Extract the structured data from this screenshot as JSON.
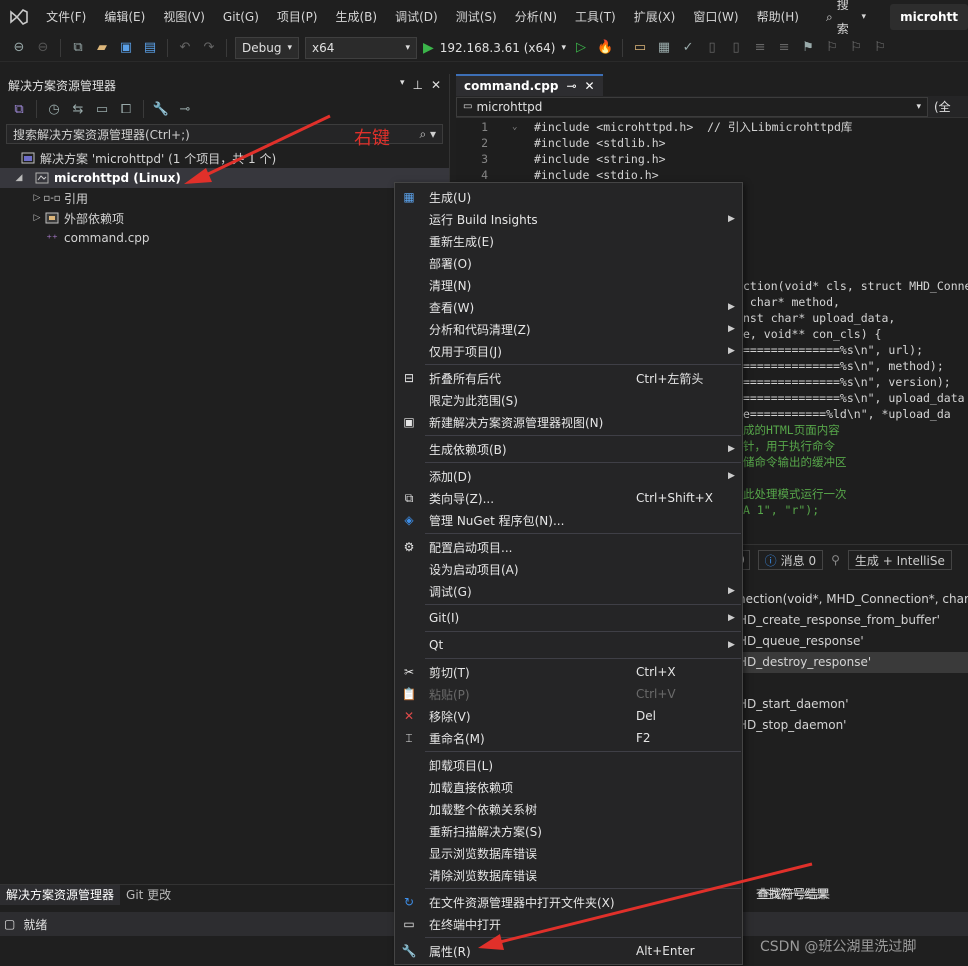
{
  "menubar": {
    "items": [
      "文件(F)",
      "编辑(E)",
      "视图(V)",
      "Git(G)",
      "项目(P)",
      "生成(B)",
      "调试(D)",
      "测试(S)",
      "分析(N)",
      "工具(T)",
      "扩展(X)",
      "窗口(W)",
      "帮助(H)"
    ],
    "search_label": "搜索",
    "solution_name": "microhtt"
  },
  "toolbar": {
    "configuration": "Debug",
    "platform": "x64",
    "run_target": "192.168.3.61 (x64)"
  },
  "solution_explorer": {
    "title": "解决方案资源管理器",
    "search_placeholder": "搜索解决方案资源管理器(Ctrl+;)",
    "tree": {
      "solution": "解决方案 'microhttpd' (1 个项目，共 1 个)",
      "project": "microhttpd (Linux)",
      "references": "引用",
      "external_deps": "外部依赖项",
      "file": "command.cpp"
    },
    "annotation": "右键"
  },
  "editor": {
    "tab_label": "command.cpp",
    "nav_project": "microhttpd",
    "nav_scope": "(全",
    "lines": [
      {
        "num": "1",
        "text": "#include <microhttpd.h>  // 引入Libmicrohttpd库"
      },
      {
        "num": "2",
        "text": "#include <stdlib.h>"
      },
      {
        "num": "3",
        "text": "#include <string.h>"
      },
      {
        "num": "4",
        "text": "#include <stdio.h>"
      }
    ],
    "fragments": [
      "ction(void* cls, struct MHD_Conne",
      " char* method,",
      "nst char* upload_data,",
      "e, void** con_cls) {",
      "==============%s\\n\", url);",
      "==============%s\\n\", method);",
      "==============%s\\n\", version);",
      "==============%s\\n\", upload_data",
      "e===========%ld\\n\", *upload_da",
      "成的HTML页面内容",
      "针，用于执行命令",
      "储命令输出的缓冲区",
      "",
      "此处理模式运行一次",
      "A 1\", \"r\");"
    ]
  },
  "output": {
    "errors_count": "0",
    "messages_label": "消息 0",
    "filter": "生成 + IntelliSe",
    "lines": [
      "nection(void*, MHD_Connection*, char c",
      "HD_create_response_from_buffer'",
      "HD_queue_response'",
      "HD_destroy_response'",
      "",
      "HD_start_daemon'",
      "HD_stop_daemon'"
    ],
    "find_symbol_tab": "查找符号结果"
  },
  "bottom_tabs": [
    "解决方案资源管理器",
    "Git 更改"
  ],
  "status": {
    "text": "就绪"
  },
  "watermark": "CSDN @班公湖里洗过脚",
  "context_menu": {
    "items": [
      {
        "label": "生成(U)",
        "icon": "build-icon",
        "shortcut": "",
        "submenu": false,
        "disabled": false
      },
      {
        "label": "运行 Build Insights",
        "icon": "",
        "shortcut": "",
        "submenu": true,
        "disabled": false
      },
      {
        "label": "重新生成(E)",
        "icon": "",
        "shortcut": "",
        "submenu": false,
        "disabled": false
      },
      {
        "label": "部署(O)",
        "icon": "",
        "shortcut": "",
        "submenu": false,
        "disabled": false
      },
      {
        "label": "清理(N)",
        "icon": "",
        "shortcut": "",
        "submenu": false,
        "disabled": false
      },
      {
        "label": "查看(W)",
        "icon": "",
        "shortcut": "",
        "submenu": true,
        "disabled": false
      },
      {
        "label": "分析和代码清理(Z)",
        "icon": "",
        "shortcut": "",
        "submenu": true,
        "disabled": false
      },
      {
        "label": "仅用于项目(J)",
        "icon": "",
        "shortcut": "",
        "submenu": true,
        "disabled": false
      },
      {
        "sep": true
      },
      {
        "label": "折叠所有后代",
        "icon": "collapse-icon",
        "shortcut": "Ctrl+左箭头",
        "submenu": false,
        "disabled": false
      },
      {
        "label": "限定为此范围(S)",
        "icon": "",
        "shortcut": "",
        "submenu": false,
        "disabled": false
      },
      {
        "label": "新建解决方案资源管理器视图(N)",
        "icon": "new-view-icon",
        "shortcut": "",
        "submenu": false,
        "disabled": false
      },
      {
        "sep": true
      },
      {
        "label": "生成依赖项(B)",
        "icon": "",
        "shortcut": "",
        "submenu": true,
        "disabled": false
      },
      {
        "sep": true
      },
      {
        "label": "添加(D)",
        "icon": "",
        "shortcut": "",
        "submenu": true,
        "disabled": false
      },
      {
        "label": "类向导(Z)...",
        "icon": "class-wizard-icon",
        "shortcut": "Ctrl+Shift+X",
        "submenu": false,
        "disabled": false
      },
      {
        "label": "管理 NuGet 程序包(N)...",
        "icon": "nuget-icon",
        "shortcut": "",
        "submenu": false,
        "disabled": false
      },
      {
        "sep": true
      },
      {
        "label": "配置启动项目...",
        "icon": "gear-icon",
        "shortcut": "",
        "submenu": false,
        "disabled": false
      },
      {
        "label": "设为启动项目(A)",
        "icon": "",
        "shortcut": "",
        "submenu": false,
        "disabled": false
      },
      {
        "label": "调试(G)",
        "icon": "",
        "shortcut": "",
        "submenu": true,
        "disabled": false
      },
      {
        "sep": true
      },
      {
        "label": "Git(I)",
        "icon": "",
        "shortcut": "",
        "submenu": true,
        "disabled": false
      },
      {
        "sep": true
      },
      {
        "label": "Qt",
        "icon": "",
        "shortcut": "",
        "submenu": true,
        "disabled": false
      },
      {
        "sep": true
      },
      {
        "label": "剪切(T)",
        "icon": "cut-icon",
        "shortcut": "Ctrl+X",
        "submenu": false,
        "disabled": false
      },
      {
        "label": "粘贴(P)",
        "icon": "paste-icon",
        "shortcut": "Ctrl+V",
        "submenu": false,
        "disabled": true
      },
      {
        "label": "移除(V)",
        "icon": "remove-icon",
        "shortcut": "Del",
        "submenu": false,
        "disabled": false
      },
      {
        "label": "重命名(M)",
        "icon": "rename-icon",
        "shortcut": "F2",
        "submenu": false,
        "disabled": false
      },
      {
        "sep": true
      },
      {
        "label": "卸载项目(L)",
        "icon": "",
        "shortcut": "",
        "submenu": false,
        "disabled": false
      },
      {
        "label": "加载直接依赖项",
        "icon": "",
        "shortcut": "",
        "submenu": false,
        "disabled": false
      },
      {
        "label": "加载整个依赖关系树",
        "icon": "",
        "shortcut": "",
        "submenu": false,
        "disabled": false
      },
      {
        "label": "重新扫描解决方案(S)",
        "icon": "",
        "shortcut": "",
        "submenu": false,
        "disabled": false
      },
      {
        "label": "显示浏览数据库错误",
        "icon": "",
        "shortcut": "",
        "submenu": false,
        "disabled": false
      },
      {
        "label": "清除浏览数据库错误",
        "icon": "",
        "shortcut": "",
        "submenu": false,
        "disabled": false
      },
      {
        "sep": true
      },
      {
        "label": "在文件资源管理器中打开文件夹(X)",
        "icon": "open-folder-icon",
        "shortcut": "",
        "submenu": false,
        "disabled": false
      },
      {
        "label": "在终端中打开",
        "icon": "terminal-icon",
        "shortcut": "",
        "submenu": false,
        "disabled": false
      },
      {
        "sep": true
      },
      {
        "label": "属性(R)",
        "icon": "wrench-icon",
        "shortcut": "Alt+Enter",
        "submenu": false,
        "disabled": false
      }
    ]
  },
  "colors": {
    "annotation_red": "#e0302a",
    "accent_blue": "#3d6fb6",
    "run_green": "#3bb54a"
  }
}
